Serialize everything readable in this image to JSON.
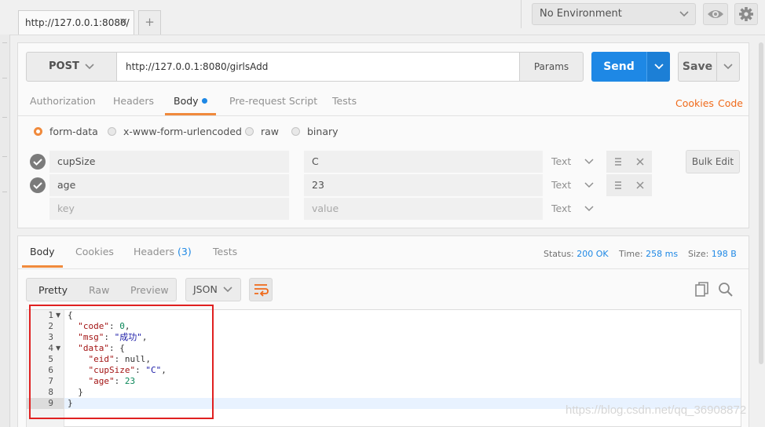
{
  "tabs": [
    {
      "label": "http://127.0.0.1:8080/",
      "close": "×"
    }
  ],
  "add_tab": "+",
  "environment": {
    "selected": "No Environment"
  },
  "icons": {
    "eye": "eye-icon",
    "gear": "gear-icon",
    "chevron": "chevron-down-icon",
    "check": "check-icon",
    "menu": "drag-icon",
    "close": "close-icon",
    "copy": "copy-icon",
    "search": "search-icon",
    "wrap": "wrap-lines-icon"
  },
  "request": {
    "method": "POST",
    "url": "http://127.0.0.1:8080/girlsAdd",
    "params_label": "Params",
    "send_label": "Send",
    "save_label": "Save"
  },
  "request_tabs": [
    "Authorization",
    "Headers",
    "Body",
    "Pre-request Script",
    "Tests"
  ],
  "request_tab_active": "Body",
  "links": {
    "cookies": "Cookies",
    "code": "Code"
  },
  "body_modes": [
    "form-data",
    "x-www-form-urlencoded",
    "raw",
    "binary"
  ],
  "body_mode_selected": "form-data",
  "form_rows": [
    {
      "key": "cupSize",
      "value": "C",
      "type": "Text"
    },
    {
      "key": "age",
      "value": "23",
      "type": "Text"
    }
  ],
  "form_placeholder": {
    "key": "key",
    "value": "value",
    "type": "Text"
  },
  "bulk_edit_label": "Bulk Edit",
  "response": {
    "tabs": [
      "Body",
      "Cookies",
      "Headers",
      "Tests"
    ],
    "headers_count": "(3)",
    "active_tab": "Body",
    "status_label": "Status:",
    "status_value": "200 OK",
    "time_label": "Time:",
    "time_value": "258 ms",
    "size_label": "Size:",
    "size_value": "198 B",
    "formats": [
      "Pretty",
      "Raw",
      "Preview"
    ],
    "format_active": "Pretty",
    "language": "JSON",
    "code_lines": [
      {
        "n": "1",
        "fold": true,
        "text": "{"
      },
      {
        "n": "2",
        "key": "\"code\"",
        "sep": ": ",
        "val": "0",
        "vt": "n",
        "end": ","
      },
      {
        "n": "3",
        "key": "\"msg\"",
        "sep": ": ",
        "val": "\"成功\"",
        "vt": "s",
        "end": ","
      },
      {
        "n": "4",
        "fold": true,
        "key": "\"data\"",
        "sep": ": ",
        "val": "{",
        "vt": "p",
        "end": ""
      },
      {
        "n": "5",
        "indent": 2,
        "key": "\"eid\"",
        "sep": ": ",
        "val": "null",
        "vt": "p",
        "end": ","
      },
      {
        "n": "6",
        "indent": 2,
        "key": "\"cupSize\"",
        "sep": ": ",
        "val": "\"C\"",
        "vt": "s",
        "end": ","
      },
      {
        "n": "7",
        "indent": 2,
        "key": "\"age\"",
        "sep": ": ",
        "val": "23",
        "vt": "n",
        "end": ""
      },
      {
        "n": "8",
        "text": "  }"
      },
      {
        "n": "9",
        "text": "}"
      }
    ]
  },
  "watermark": "https://blog.csdn.net/qq_36908872"
}
